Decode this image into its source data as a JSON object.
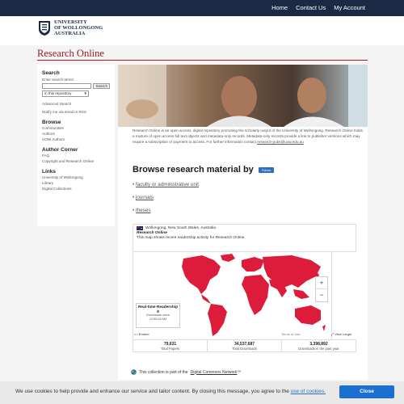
{
  "topnav": {
    "home": "Home",
    "contact": "Contact Us",
    "account": "My Account"
  },
  "logo": {
    "line1": "UNIVERSITY",
    "line2": "OF WOLLONGONG",
    "line3": "AUSTRALIA"
  },
  "site": {
    "title": "Research Online"
  },
  "sidebar": {
    "search_heading": "Search",
    "search_label": "Enter search terms:",
    "search_button": "Search",
    "search_scope": "in this repository",
    "advanced_search": "Advanced Search",
    "notify": "Notify me via email or RSS",
    "browse_heading": "Browse",
    "browse_items": [
      "Communities",
      "Authors",
      "UOW Authors"
    ],
    "author_heading": "Author Corner",
    "author_items": [
      "FAQ",
      "Copyright and Research Online"
    ],
    "links_heading": "Links",
    "links_items": [
      "University of Wollongong",
      "Library",
      "Digital Collections"
    ]
  },
  "intro": {
    "text": "Research Online is an open access, digital repository promoting the scholarly output of the University of Wollongong. Research Online holds a mixture of open access full text objects and metadata-only records. Metadata-only records provide a link to publisher versions which may require a subscription or payment to access. For further information contact",
    "email": "research-pubs@uow.edu.au"
  },
  "browse": {
    "title": "Browse research material by",
    "follow": "Follow",
    "items": [
      "faculty or administrative unit",
      "journals",
      "theses"
    ]
  },
  "map": {
    "location": "Wollongong, New South Wales, Australia",
    "subtitle": "Research Online",
    "description": "This map shows recent readership activity for Research Online.",
    "realtime_title": "Real-time Readership",
    "realtime_count": "8",
    "realtime_sub1": "Downloads since",
    "realtime_sub2": "12:59:28 AM",
    "embed": "<> Embed",
    "terms": "Terms of Use",
    "view_larger": "View Larger",
    "zoom_in": "+",
    "zoom_out": "−",
    "colors": {
      "land": "#dc1c3a",
      "ocean": "#ffffff"
    }
  },
  "stats": [
    {
      "value": "79,631",
      "label": "Total Papers"
    },
    {
      "value": "34,537,687",
      "label": "Total Downloads"
    },
    {
      "value": "3,398,892",
      "label": "Downloads in the past year"
    }
  ],
  "dcn": {
    "text": "This collection is part of the",
    "link": "Digital Commons Network",
    "tm": "™"
  },
  "cookie": {
    "text": "We use cookies to help provide and enhance our service and tailor content. By closing this message, you agree to the",
    "link": "use of cookies.",
    "close": "Close"
  }
}
